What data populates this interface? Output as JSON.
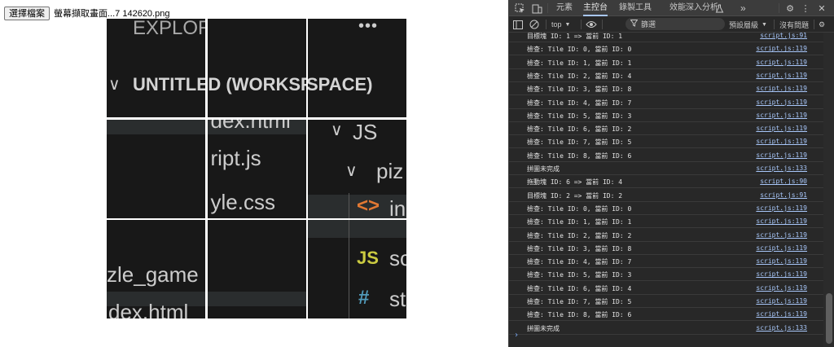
{
  "file_input": {
    "button_label": "選擇檔案",
    "file_name": "螢幕擷取畫面...7 142620.png"
  },
  "tiles": [
    {
      "texts": {
        "explorer": "EXPLORER",
        "untitled": "UNTITLED (WORK"
      }
    },
    {
      "texts": {
        "untitled": "UNTITLED (WORKSPACE)"
      }
    },
    {
      "texts": {
        "ellipsis": "•••",
        "untitled": "SPACE)"
      }
    },
    {
      "texts": {
        "bottom": "dex.html"
      }
    },
    {
      "texts": {
        "top": "dex.html",
        "script": "ript.js",
        "style": "yle.css"
      }
    },
    {
      "texts": {
        "top": "JS",
        "piz": "piz",
        "in": "in"
      }
    },
    {
      "texts": {
        "puzzle": "zle_game",
        "index": "dex.html"
      }
    },
    {
      "texts": {}
    },
    {
      "texts": {
        "js_icon": "JS",
        "sc": "sc",
        "hash": "#",
        "st": "st"
      }
    }
  ],
  "devtools": {
    "tabs": [
      "元素",
      "主控台",
      "錄製工具",
      "效能深入分析"
    ],
    "active_tab": "主控台",
    "more": "»",
    "context": "top",
    "filter_placeholder": "篩選",
    "levels": "預設層級",
    "issues": "沒有問題",
    "prompt": "›",
    "messages": [
      {
        "text": "目標塊 ID: 1 => 當前 ID: 1",
        "source": "script.js:91"
      },
      {
        "text": "檢查: Tile ID: 0, 當前 ID: 0",
        "source": "script.js:119"
      },
      {
        "text": "檢查: Tile ID: 1, 當前 ID: 1",
        "source": "script.js:119"
      },
      {
        "text": "檢查: Tile ID: 2, 當前 ID: 4",
        "source": "script.js:119"
      },
      {
        "text": "檢查: Tile ID: 3, 當前 ID: 8",
        "source": "script.js:119"
      },
      {
        "text": "檢查: Tile ID: 4, 當前 ID: 7",
        "source": "script.js:119"
      },
      {
        "text": "檢查: Tile ID: 5, 當前 ID: 3",
        "source": "script.js:119"
      },
      {
        "text": "檢查: Tile ID: 6, 當前 ID: 2",
        "source": "script.js:119"
      },
      {
        "text": "檢查: Tile ID: 7, 當前 ID: 5",
        "source": "script.js:119"
      },
      {
        "text": "檢查: Tile ID: 8, 當前 ID: 6",
        "source": "script.js:119"
      },
      {
        "text": "拼圖未完成",
        "source": "script.js:133"
      },
      {
        "text": "拖動塊 ID: 6 => 當前 ID: 4",
        "source": "script.js:90"
      },
      {
        "text": "目標塊 ID: 2 => 當前 ID: 2",
        "source": "script.js:91"
      },
      {
        "text": "檢查: Tile ID: 0, 當前 ID: 0",
        "source": "script.js:119"
      },
      {
        "text": "檢查: Tile ID: 1, 當前 ID: 1",
        "source": "script.js:119"
      },
      {
        "text": "檢查: Tile ID: 2, 當前 ID: 2",
        "source": "script.js:119"
      },
      {
        "text": "檢查: Tile ID: 3, 當前 ID: 8",
        "source": "script.js:119"
      },
      {
        "text": "檢查: Tile ID: 4, 當前 ID: 7",
        "source": "script.js:119"
      },
      {
        "text": "檢查: Tile ID: 5, 當前 ID: 3",
        "source": "script.js:119"
      },
      {
        "text": "檢查: Tile ID: 6, 當前 ID: 4",
        "source": "script.js:119"
      },
      {
        "text": "檢查: Tile ID: 7, 當前 ID: 5",
        "source": "script.js:119"
      },
      {
        "text": "檢查: Tile ID: 8, 當前 ID: 6",
        "source": "script.js:119"
      },
      {
        "text": "拼圖未完成",
        "source": "script.js:133"
      }
    ]
  },
  "colors": {
    "tile_bg": "#181818",
    "highlight_band": "#2a2d2e",
    "selected_band": "#37373d",
    "html_icon": "#e37933",
    "js_icon": "#cbcb41",
    "css_icon": "#519aba",
    "link": "#a8c7fa",
    "devtools_bg": "#282828"
  },
  "icons": {
    "inspect": "inspect-element-icon",
    "device": "device-toolbar-icon",
    "settings": "gear-icon",
    "menu": "kebab-menu-icon",
    "close": "close-icon",
    "sidebar": "sidebar-toggle-icon",
    "clear": "clear-console-icon",
    "eye": "eye-icon",
    "filter": "filter-icon",
    "flask": "flask-icon",
    "chevron": "chevron-down-icon",
    "html_file": "html-file-icon"
  }
}
